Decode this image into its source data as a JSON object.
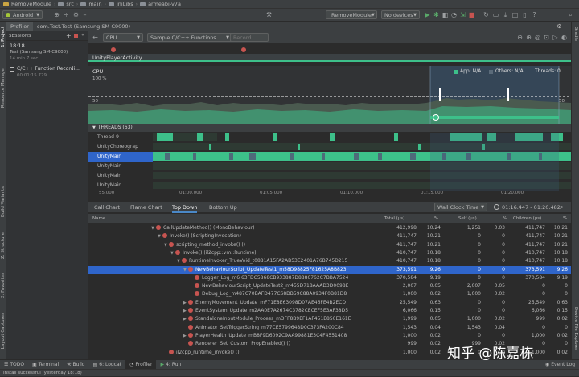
{
  "breadcrumbs": [
    "RemoveModule",
    "src",
    "main",
    "jniLibs",
    "armeabi-v7a"
  ],
  "toolbar": {
    "device": "Android",
    "run_config": "RemoveModule",
    "device_selector": "No devices"
  },
  "profiler_tabs": [
    "Profiler",
    "com.Test.Test (Samsung SM-C9000)"
  ],
  "left_tools": [
    "1: Project",
    "Resource Manager",
    "Build Variants",
    "Z: Structure",
    "2: Favorites",
    "Layout Captures"
  ],
  "right_tools": [
    "Gradle",
    "Device File Explorer"
  ],
  "sessions": {
    "header": "SESSIONS",
    "items": [
      {
        "time": "18:18",
        "device": "Test (Samsung SM-C9000)",
        "ago": "14 min 7 sec"
      },
      {
        "title": "C/C++ Function Recordi...",
        "duration": "00:01:15.779"
      }
    ]
  },
  "controls": {
    "profiler": "CPU",
    "config": "Sample C/C++ Functions",
    "record": "Record"
  },
  "activity": "UnityPlayerActivity",
  "cpu": {
    "label": "CPU",
    "y100": "100 %",
    "y50": "50",
    "y50r": "50",
    "legend_app": "App: N/A",
    "legend_others": "Others: N/A",
    "legend_threads": "Threads: 0"
  },
  "threads_section": {
    "header": "THREADS (63)",
    "items": [
      "Thread-9",
      "UnityChoreograp",
      "UnityMain",
      "UnityMain",
      "UnityMain",
      "UnityMain"
    ]
  },
  "time_axis": [
    "55.000",
    "01:00.000",
    "01:05.000",
    "01:10.000",
    "01:15.000",
    "01:20.000"
  ],
  "analysis_tabs": [
    "Call Chart",
    "Flame Chart",
    "Top Down",
    "Bottom Up"
  ],
  "clock": "Wall Clock Time",
  "time_range": "01:16.447 - 01:20.482",
  "tree": {
    "columns": [
      "Name",
      "Total (µs)",
      "%",
      "Self (µs)",
      "%",
      "Children (µs)",
      "%"
    ],
    "rows": [
      {
        "indent": 10,
        "tri": "▼",
        "icon": true,
        "name": "CallUpdateMethod() (MonoBehaviour)",
        "total": "412,998",
        "tp": "10.24",
        "self": "1,251",
        "sp": "0.03",
        "child": "411,747",
        "cp": "10.21"
      },
      {
        "indent": 11,
        "tri": "▼",
        "icon": true,
        "name": "Invoke() (ScriptingInvocation)",
        "total": "411,747",
        "tp": "10.21",
        "self": "0",
        "sp": "0",
        "child": "411,747",
        "cp": "10.21"
      },
      {
        "indent": 12,
        "tri": "▼",
        "icon": true,
        "name": "scripting_method_invoke() ()",
        "total": "411,747",
        "tp": "10.21",
        "self": "0",
        "sp": "0",
        "child": "411,747",
        "cp": "10.21"
      },
      {
        "indent": 13,
        "tri": "▼",
        "icon": true,
        "name": "Invoke() (il2cpp::vm::Runtime)",
        "total": "410,747",
        "tp": "10.18",
        "self": "0",
        "sp": "0",
        "child": "410,747",
        "cp": "10.18"
      },
      {
        "indent": 14,
        "tri": "▼",
        "icon": true,
        "name": "RuntimeInvoker_TrueVoid_t0881A15FA2AB53E2401A76B745D215",
        "total": "410,747",
        "tp": "10.18",
        "self": "0",
        "sp": "0",
        "child": "410,747",
        "cp": "10.18"
      },
      {
        "indent": 15,
        "tri": "▼",
        "icon": true,
        "name": "NewBehaviourScript_UpdateTest1_m58D98825F81625A8B823",
        "total": "373,591",
        "tp": "9.26",
        "self": "0",
        "sp": "0",
        "child": "373,591",
        "cp": "9.26",
        "sel": true
      },
      {
        "indent": 16,
        "tri": "",
        "icon": true,
        "name": "Logger_Log_m6 63FDC5868CB933887D8886762C7BBA7524",
        "total": "370,584",
        "tp": "9.19",
        "self": "0",
        "sp": "0",
        "child": "370,584",
        "cp": "9.19"
      },
      {
        "indent": 16,
        "tri": "",
        "icon": true,
        "name": "NewBehaviourScript_UpdateTest2_m455D718AAAD3D0098E",
        "total": "2,007",
        "tp": "0.05",
        "self": "2,007",
        "sp": "0.05",
        "child": "0",
        "cp": "0"
      },
      {
        "indent": 16,
        "tri": "",
        "icon": true,
        "name": "Debug_Log_m487C70BAFD477C68DB59C88A0934F0B81D8",
        "total": "1,000",
        "tp": "0.02",
        "self": "1,000",
        "sp": "0.02",
        "child": "0",
        "cp": "0"
      },
      {
        "indent": 15,
        "tri": "▶",
        "icon": true,
        "name": "EnemyMovement_Update_mF71E8E63098D07AE46FE4B2ECD",
        "total": "25,549",
        "tp": "0.63",
        "self": "0",
        "sp": "0",
        "child": "25,549",
        "cp": "0.63"
      },
      {
        "indent": 15,
        "tri": "▶",
        "icon": true,
        "name": "EventSystem_Update_m2AA0E7A2674C3782CECEF5E3AF38D5",
        "total": "6,066",
        "tp": "0.15",
        "self": "0",
        "sp": "0",
        "child": "6,066",
        "cp": "0.15"
      },
      {
        "indent": 15,
        "tri": "▶",
        "icon": true,
        "name": "StandaloneInputModule_Process_mDFF8B9EF1AF451E850E161E",
        "total": "1,999",
        "tp": "0.05",
        "self": "1,000",
        "sp": "0.02",
        "child": "999",
        "cp": "0.02"
      },
      {
        "indent": 15,
        "tri": "",
        "icon": true,
        "name": "Animator_SetTriggerString_m77CE5799648D0C373FA200C84",
        "total": "1,543",
        "tp": "0.04",
        "self": "1,543",
        "sp": "0.04",
        "child": "0",
        "cp": "0"
      },
      {
        "indent": 15,
        "tri": "▶",
        "icon": true,
        "name": "PlayerHealth_Update_mB8F9D6092C9AA99881E3C4F4551408",
        "total": "1,000",
        "tp": "0.02",
        "self": "0",
        "sp": "0",
        "child": "1,000",
        "cp": "0.02"
      },
      {
        "indent": 15,
        "tri": "",
        "icon": true,
        "name": "Renderer_Set_Custom_PropEnabled() ()",
        "total": "999",
        "tp": "0.02",
        "self": "999",
        "sp": "0.02",
        "child": "0",
        "cp": "0"
      },
      {
        "indent": 12,
        "tri": "",
        "icon": true,
        "name": "il2cpp_runtime_invoke() ()",
        "total": "1,000",
        "tp": "0.02",
        "self": "0",
        "sp": "0",
        "child": "1,000",
        "cp": "0.02"
      }
    ]
  },
  "bottom_tabs": [
    "TODO",
    "Terminal",
    "Build",
    "6: Logcat",
    "Profiler",
    "4: Run"
  ],
  "event_log": "Event Log",
  "status": "Install successful (yesterday 18:18)",
  "watermark": "知乎 @陈嘉栋",
  "colors": {
    "accent": "#3dc08a",
    "selection": "#2f65ca",
    "method_icon": "#c75450",
    "bg": "#2b2b2b",
    "panel": "#3c3f41"
  }
}
